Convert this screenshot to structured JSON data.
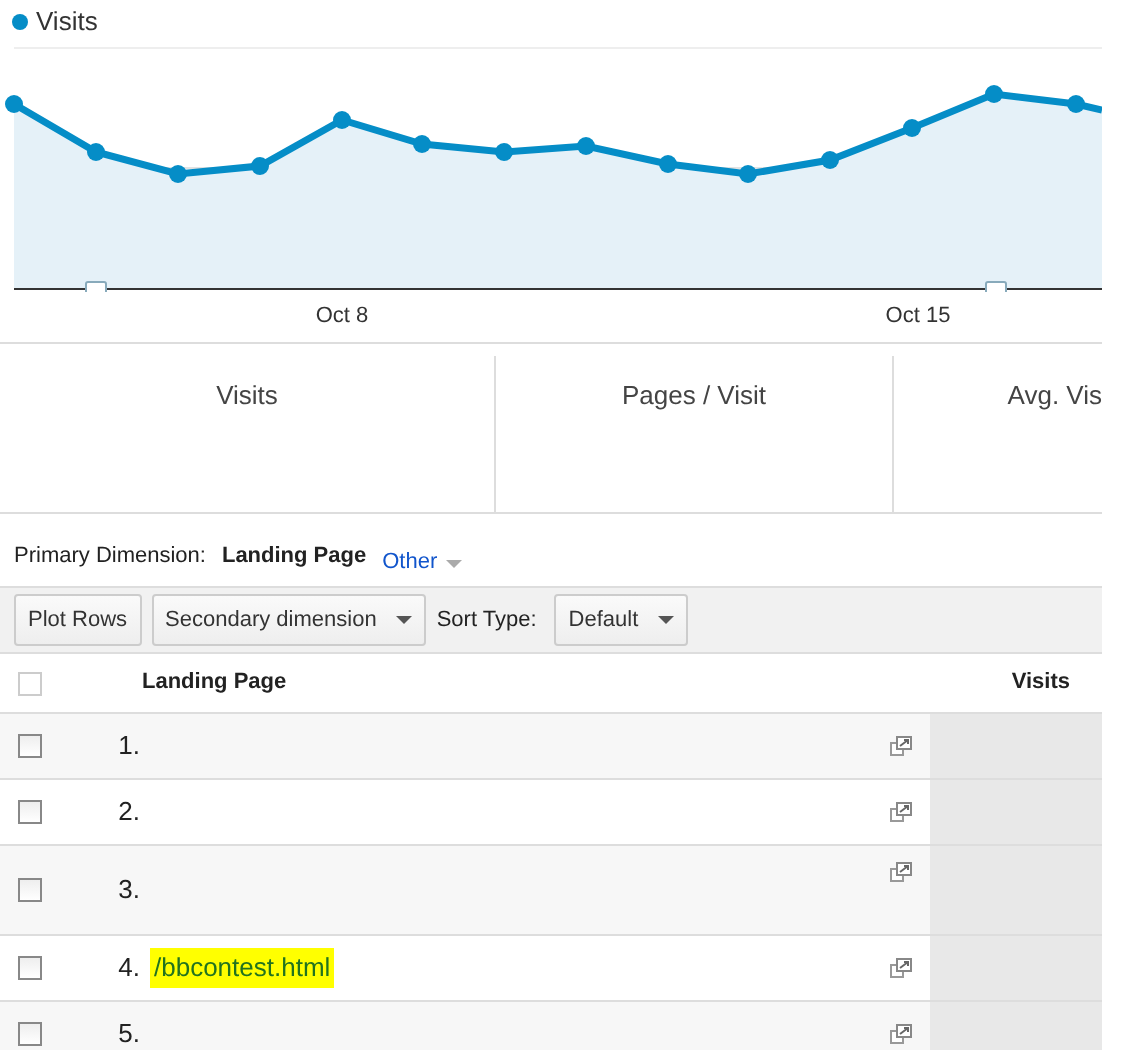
{
  "legend": {
    "label": "Visits"
  },
  "chart": {
    "kind": "picture",
    "x_labels": [
      "Oct 8",
      "Oct 15"
    ]
  },
  "metric_tabs": [
    {
      "label": "Visits"
    },
    {
      "label": "Pages / Visit"
    },
    {
      "label": "Avg. Vis"
    }
  ],
  "primary_dimension": {
    "label": "Primary Dimension:",
    "selected": "Landing Page",
    "other": "Other"
  },
  "toolbar": {
    "plot_rows": "Plot Rows",
    "secondary_dimension": "Secondary dimension",
    "sort_label": "Sort Type:",
    "sort_value": "Default"
  },
  "table": {
    "select_all": {
      "checked": false
    },
    "columns": [
      "Landing Page",
      "Visits"
    ],
    "rows": [
      {
        "index": "1.",
        "checked": false,
        "highlighted": false,
        "tall": false
      },
      {
        "index": "2.",
        "checked": false,
        "highlighted": false,
        "tall": false
      },
      {
        "index": "3.",
        "checked": false,
        "highlighted": false,
        "tall": true
      },
      {
        "index": "4.",
        "page": "/bbcontest.html",
        "checked": false,
        "highlighted": true,
        "tall": false
      },
      {
        "index": "5.",
        "checked": false,
        "highlighted": false,
        "tall": false
      }
    ]
  }
}
